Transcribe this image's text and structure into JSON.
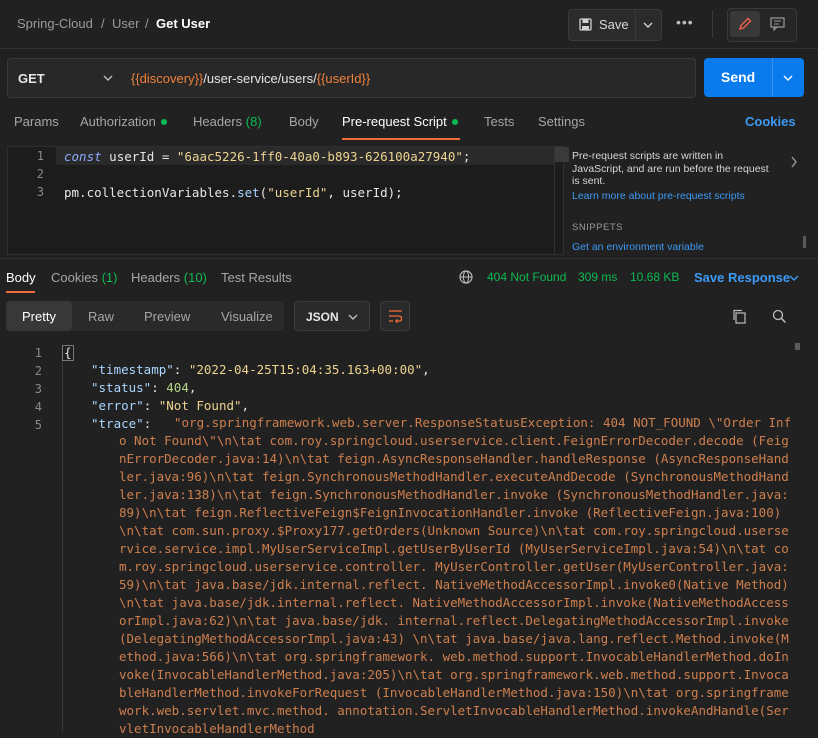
{
  "breadcrumb": {
    "items": [
      "Spring-Cloud",
      "User"
    ],
    "current": "Get User",
    "separator": "/"
  },
  "header": {
    "save_label": "Save",
    "more_label": "•••"
  },
  "request": {
    "method": "GET",
    "url_parts": [
      {
        "text": "{{discovery}}",
        "var": true
      },
      {
        "text": "/user-service/users/",
        "var": false
      },
      {
        "text": "{{userId}}",
        "var": true
      }
    ],
    "send_label": "Send"
  },
  "request_tabs": [
    {
      "label": "Params"
    },
    {
      "label": "Authorization",
      "dot": true
    },
    {
      "label": "Headers",
      "count": "(8)"
    },
    {
      "label": "Body"
    },
    {
      "label": "Pre-request Script",
      "dot": true,
      "active": true
    },
    {
      "label": "Tests"
    },
    {
      "label": "Settings"
    }
  ],
  "cookies_label": "Cookies",
  "script": {
    "line_numbers": [
      "1",
      "2",
      "3"
    ],
    "line1": {
      "kw": "const",
      "ident": " userId = ",
      "str": "\"6aac5226-1ff0-40a0-b893-626100a27940\"",
      "end": ";"
    },
    "line3": {
      "obj": "pm.collectionVariables.",
      "fn": "set",
      "open": "(",
      "str": "\"userId\"",
      "rest": ", userId);"
    }
  },
  "side_panel": {
    "text": "Pre-request scripts are written in JavaScript, and are run before the request is sent.",
    "link": "Learn more about pre-request scripts",
    "heading": "SNIPPETS",
    "snippet": "Get an environment variable"
  },
  "response_tabs": [
    {
      "label": "Body",
      "active": true
    },
    {
      "label": "Cookies",
      "count": "(1)"
    },
    {
      "label": "Headers",
      "count": "(10)"
    },
    {
      "label": "Test Results"
    }
  ],
  "status": {
    "code": "404 Not Found",
    "time": "309 ms",
    "size": "10.68 KB",
    "save_label": "Save Response"
  },
  "view_tabs": [
    "Pretty",
    "Raw",
    "Preview",
    "Visualize"
  ],
  "format": "JSON",
  "response": {
    "line_numbers": [
      "1",
      "2",
      "3",
      "4",
      "5"
    ],
    "open_brace": "{",
    "fields": [
      {
        "key": "\"timestamp\"",
        "value": "\"2022-04-25T15:04:35.163+00:00\""
      },
      {
        "key": "\"status\"",
        "value": "404"
      },
      {
        "key": "\"error\"",
        "value": "\"Not Found\""
      },
      {
        "key": "\"trace\""
      }
    ],
    "trace": "\"org.springframework.web.server.ResponseStatusException: 404 NOT_FOUND \\\"Order Info Not Found\\\"\\n\\tat com.roy.springcloud.userservice.client.FeignErrorDecoder.decode (FeignErrorDecoder.java:14)\\n\\tat feign.AsyncResponseHandler.handleResponse (AsyncResponseHandler.java:96)\\n\\tat feign.SynchronousMethodHandler.executeAndDecode (SynchronousMethodHandler.java:138)\\n\\tat feign.SynchronousMethodHandler.invoke (SynchronousMethodHandler.java:89)\\n\\tat feign.ReflectiveFeign$FeignInvocationHandler.invoke (ReflectiveFeign.java:100)\\n\\tat com.sun.proxy.$Proxy177.getOrders(Unknown Source)\\n\\tat com.roy.springcloud.userservice.service.impl.MyUserServiceImpl.getUserByUserId (MyUserServiceImpl.java:54)\\n\\tat com.roy.springcloud.userservice.controller. MyUserController.getUser(MyUserController.java:59)\\n\\tat java.base/jdk.internal.reflect. NativeMethodAccessorImpl.invoke0(Native Method)\\n\\tat java.base/jdk.internal.reflect. NativeMethodAccessorImpl.invoke(NativeMethodAccessorImpl.java:62)\\n\\tat java.base/jdk. internal.reflect.DelegatingMethodAccessorImpl.invoke(DelegatingMethodAccessorImpl.java:43) \\n\\tat java.base/java.lang.reflect.Method.invoke(Method.java:566)\\n\\tat org.springframework. web.method.support.InvocableHandlerMethod.doInvoke(InvocableHandlerMethod.java:205)\\n\\tat org.springframework.web.method.support.InvocableHandlerMethod.invokeForRequest (InvocableHandlerMethod.java:150)\\n\\tat org.springframework.web.servlet.mvc.method. annotation.ServletInvocableHandlerMethod.invokeAndHandle(ServletInvocableHandlerMethod"
  }
}
